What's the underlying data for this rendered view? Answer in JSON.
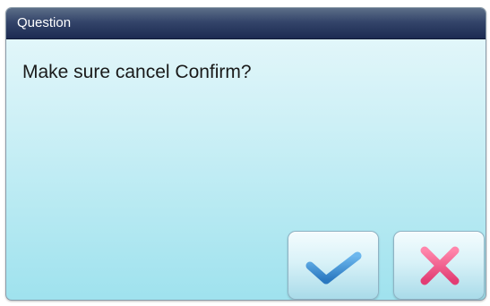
{
  "dialog": {
    "title": "Question",
    "message": "Make sure cancel Confirm?",
    "confirm_icon": "checkmark-icon",
    "cancel_icon": "close-icon",
    "colors": {
      "titlebar": "#263760",
      "confirm_icon": "#3a8ed4",
      "cancel_icon": "#f0588c"
    }
  }
}
